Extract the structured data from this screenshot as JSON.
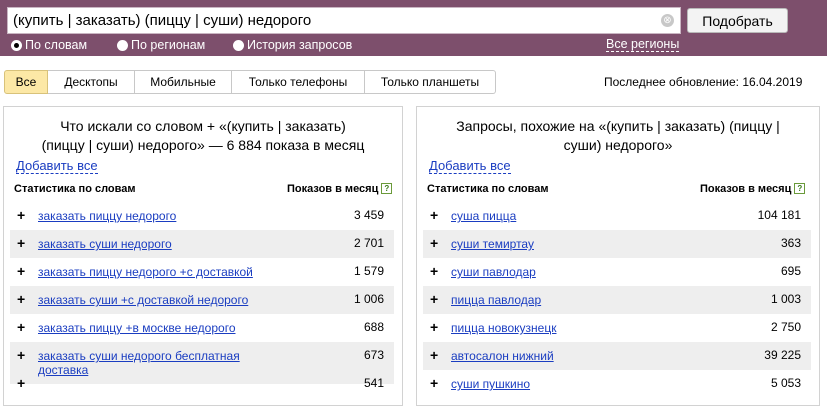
{
  "search": {
    "query": "(купить | заказать) (пиццу | суши) недорого",
    "clear": "⊗",
    "submit": "Подобрать"
  },
  "modes": [
    {
      "label": "По словам",
      "selected": true
    },
    {
      "label": "По регионам",
      "selected": false
    },
    {
      "label": "История запросов",
      "selected": false
    }
  ],
  "regions_link": "Все регионы",
  "tabs": [
    {
      "label": "Все",
      "active": true
    },
    {
      "label": "Десктопы",
      "active": false
    },
    {
      "label": "Мобильные",
      "active": false
    },
    {
      "label": "Только телефоны",
      "active": false
    },
    {
      "label": "Только планшеты",
      "active": false
    }
  ],
  "last_update": "Последнее обновление: 16.04.2019",
  "left_panel": {
    "title_line1": "Что искали со словом  +  «(купить | заказать)",
    "title_line2": "(пиццу | суши) недорого» — 6 884 показа в месяц",
    "add_all": "Добавить все",
    "col_words": "Статистика по словам",
    "col_count": "Показов в месяц",
    "rows": [
      {
        "kw": "заказать пиццу недорого",
        "count": "3 459"
      },
      {
        "kw": "заказать суши недорого",
        "count": "2 701"
      },
      {
        "kw": "заказать пиццу недорого +с доставкой",
        "count": "1 579"
      },
      {
        "kw": "заказать суши +с доставкой недорого",
        "count": "1 006"
      },
      {
        "kw": "заказать пиццу +в москве недорого",
        "count": "688"
      },
      {
        "kw": "заказать суши недорого бесплатная доставка",
        "count": "673"
      },
      {
        "kw": "",
        "count": "541"
      }
    ]
  },
  "right_panel": {
    "title_line1": "Запросы, похожие на «(купить | заказать) (пиццу |",
    "title_line2": "суши) недорого»",
    "add_all": "Добавить все",
    "col_words": "Статистика по словам",
    "col_count": "Показов в месяц",
    "rows": [
      {
        "kw": "суша пицца",
        "count": "104 181"
      },
      {
        "kw": "суши темиртау",
        "count": "363"
      },
      {
        "kw": "суши павлодар",
        "count": "695"
      },
      {
        "kw": "пицца павлодар",
        "count": "1 003"
      },
      {
        "kw": "пицца новокузнецк",
        "count": "2 750"
      },
      {
        "kw": "автосалон нижний",
        "count": "39 225"
      },
      {
        "kw": "суши пушкино",
        "count": "5 053"
      }
    ]
  },
  "plus_sign": "+",
  "help_glyph": "?"
}
